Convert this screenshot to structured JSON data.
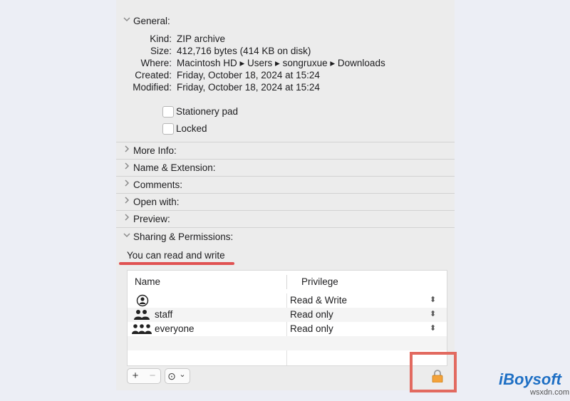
{
  "general": {
    "title": "General:",
    "rows": [
      {
        "key": "Kind:",
        "value": "ZIP archive"
      },
      {
        "key": "Size:",
        "value": "412,716 bytes (414 KB on disk)"
      },
      {
        "key": "Where:",
        "value": "Macintosh HD ▸ Users ▸ songruxue ▸ Downloads"
      },
      {
        "key": "Created:",
        "value": "Friday, October 18, 2024 at 15:24"
      },
      {
        "key": "Modified:",
        "value": "Friday, October 18, 2024 at 15:24"
      }
    ],
    "checkboxes": [
      {
        "label": "Stationery pad",
        "checked": false
      },
      {
        "label": "Locked",
        "checked": false
      }
    ]
  },
  "sections": [
    {
      "label": "More Info:"
    },
    {
      "label": "Name & Extension:"
    },
    {
      "label": "Comments:"
    },
    {
      "label": "Open with:"
    },
    {
      "label": "Preview:"
    }
  ],
  "sharing": {
    "title": "Sharing & Permissions:",
    "note": "You can read and write",
    "columns": {
      "name": "Name",
      "privilege": "Privilege"
    },
    "rows": [
      {
        "name": "",
        "privilege": "Read & Write",
        "icon": "person-icon"
      },
      {
        "name": "staff",
        "privilege": "Read only",
        "icon": "group-icon"
      },
      {
        "name": "everyone",
        "privilege": "Read only",
        "icon": "everyone-icon"
      }
    ]
  },
  "toolbar": {
    "add": "+",
    "remove": "−",
    "actions": "⊙",
    "actions_chevron": "⌄"
  },
  "branding": {
    "brand": "iBoysoft",
    "site": "wsxdn.com"
  },
  "colors": {
    "highlight": "#e26a60",
    "accent": "#1e6fc4"
  }
}
